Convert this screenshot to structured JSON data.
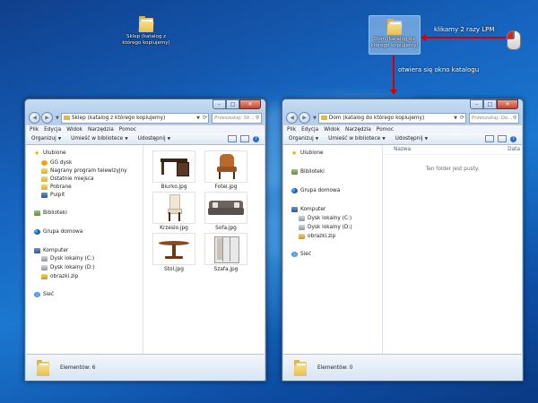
{
  "desktop": {
    "icon_source_label": "Sklep (katalog z którego kopiujemy)",
    "icon_target_label": "Dom (katalog do którego kopiujemy)"
  },
  "annotations": {
    "double_click_note": "klikamy 2 razy LPM",
    "opens_note": "otwiera się okno katalogu"
  },
  "left_window": {
    "address": "Sklep (katalog z którego kopiujemy)",
    "search_placeholder": "Przeszukaj: Sk...",
    "menu": [
      "Plik",
      "Edycja",
      "Widok",
      "Narzędzia",
      "Pomoc"
    ],
    "toolbar": [
      "Organizuj",
      "Umieść w bibliotece",
      "Udostępnij"
    ],
    "nav": {
      "favorites": "Ulubione",
      "fav_items": [
        "GG dysk",
        "Nagrany program telewizyjny",
        "Ostatnie miejsca",
        "Pobrane",
        "Pulpit"
      ],
      "libraries": "Biblioteki",
      "homegroup": "Grupa domowa",
      "computer": "Komputer",
      "computer_items": [
        "Dysk lokalny (C:)",
        "Dysk lokalny (D:)",
        "obrazki.zip"
      ],
      "network": "Sieć"
    },
    "files": [
      "Biurko.jpg",
      "Fotel.jpg",
      "Krzeslo.jpg",
      "Sofa.jpg",
      "Stol.jpg",
      "Szafa.jpg"
    ],
    "status": "Elementów: 6"
  },
  "right_window": {
    "address": "Dom (katalog do którego kopiujemy)",
    "search_placeholder": "Przeszukaj: Do...",
    "menu": [
      "Plik",
      "Edycja",
      "Widok",
      "Narzędzia",
      "Pomoc"
    ],
    "toolbar": [
      "Organizuj",
      "Umieść w bibliotece",
      "Udostępnij"
    ],
    "columns": [
      "Nazwa",
      "Data"
    ],
    "empty_message": "Ten folder jest pusty.",
    "nav": {
      "favorites": "Ulubione",
      "libraries": "Biblioteki",
      "homegroup": "Grupa domowa",
      "computer": "Komputer",
      "computer_items": [
        "Dysk lokalny (C:)",
        "Dysk lokalny (D:)",
        "obrazki.zip"
      ],
      "network": "Sieć"
    },
    "status": "Elementów: 0"
  }
}
